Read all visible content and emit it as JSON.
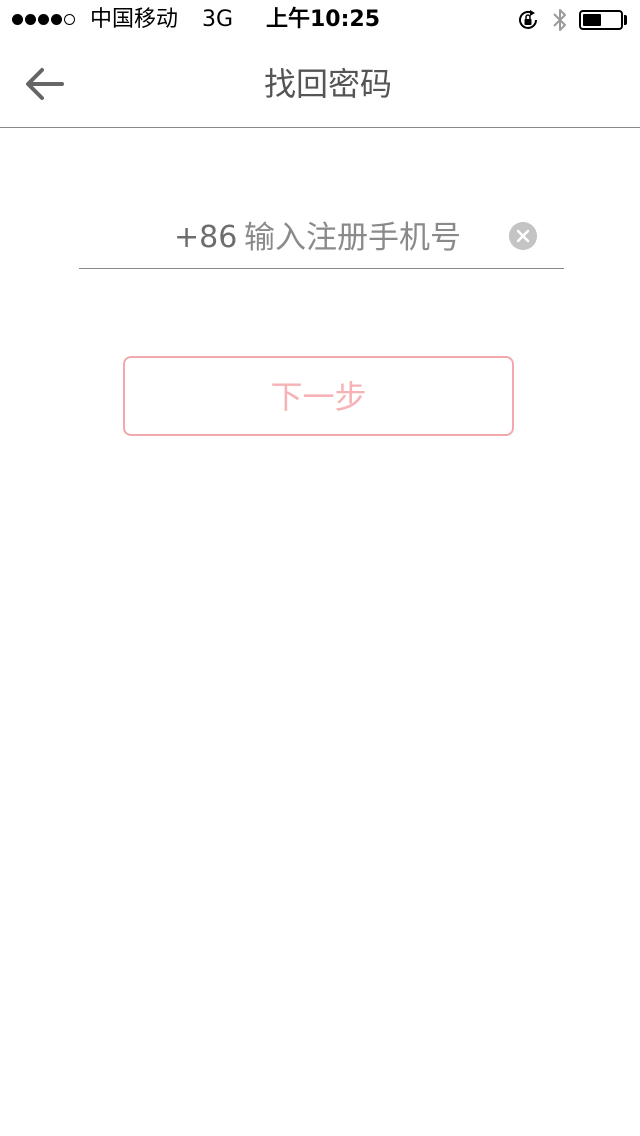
{
  "status_bar": {
    "signal_filled": 4,
    "signal_total": 5,
    "carrier": "中国移动",
    "network": "3G",
    "time": "上午10:25",
    "battery_level": 0.5,
    "icons": [
      "orientation-lock-icon",
      "bluetooth-icon",
      "battery-icon"
    ]
  },
  "nav": {
    "back_icon": "arrow-left-icon",
    "title": "找回密码"
  },
  "form": {
    "country_code": "+86",
    "phone_placeholder": "输入注册手机号",
    "phone_value": "",
    "clear_icon": "clear-circle-icon",
    "next_label": "下一步"
  },
  "colors": {
    "accent": "#f2a9ad",
    "text_gray": "#6d6d6d",
    "divider": "#888888"
  }
}
